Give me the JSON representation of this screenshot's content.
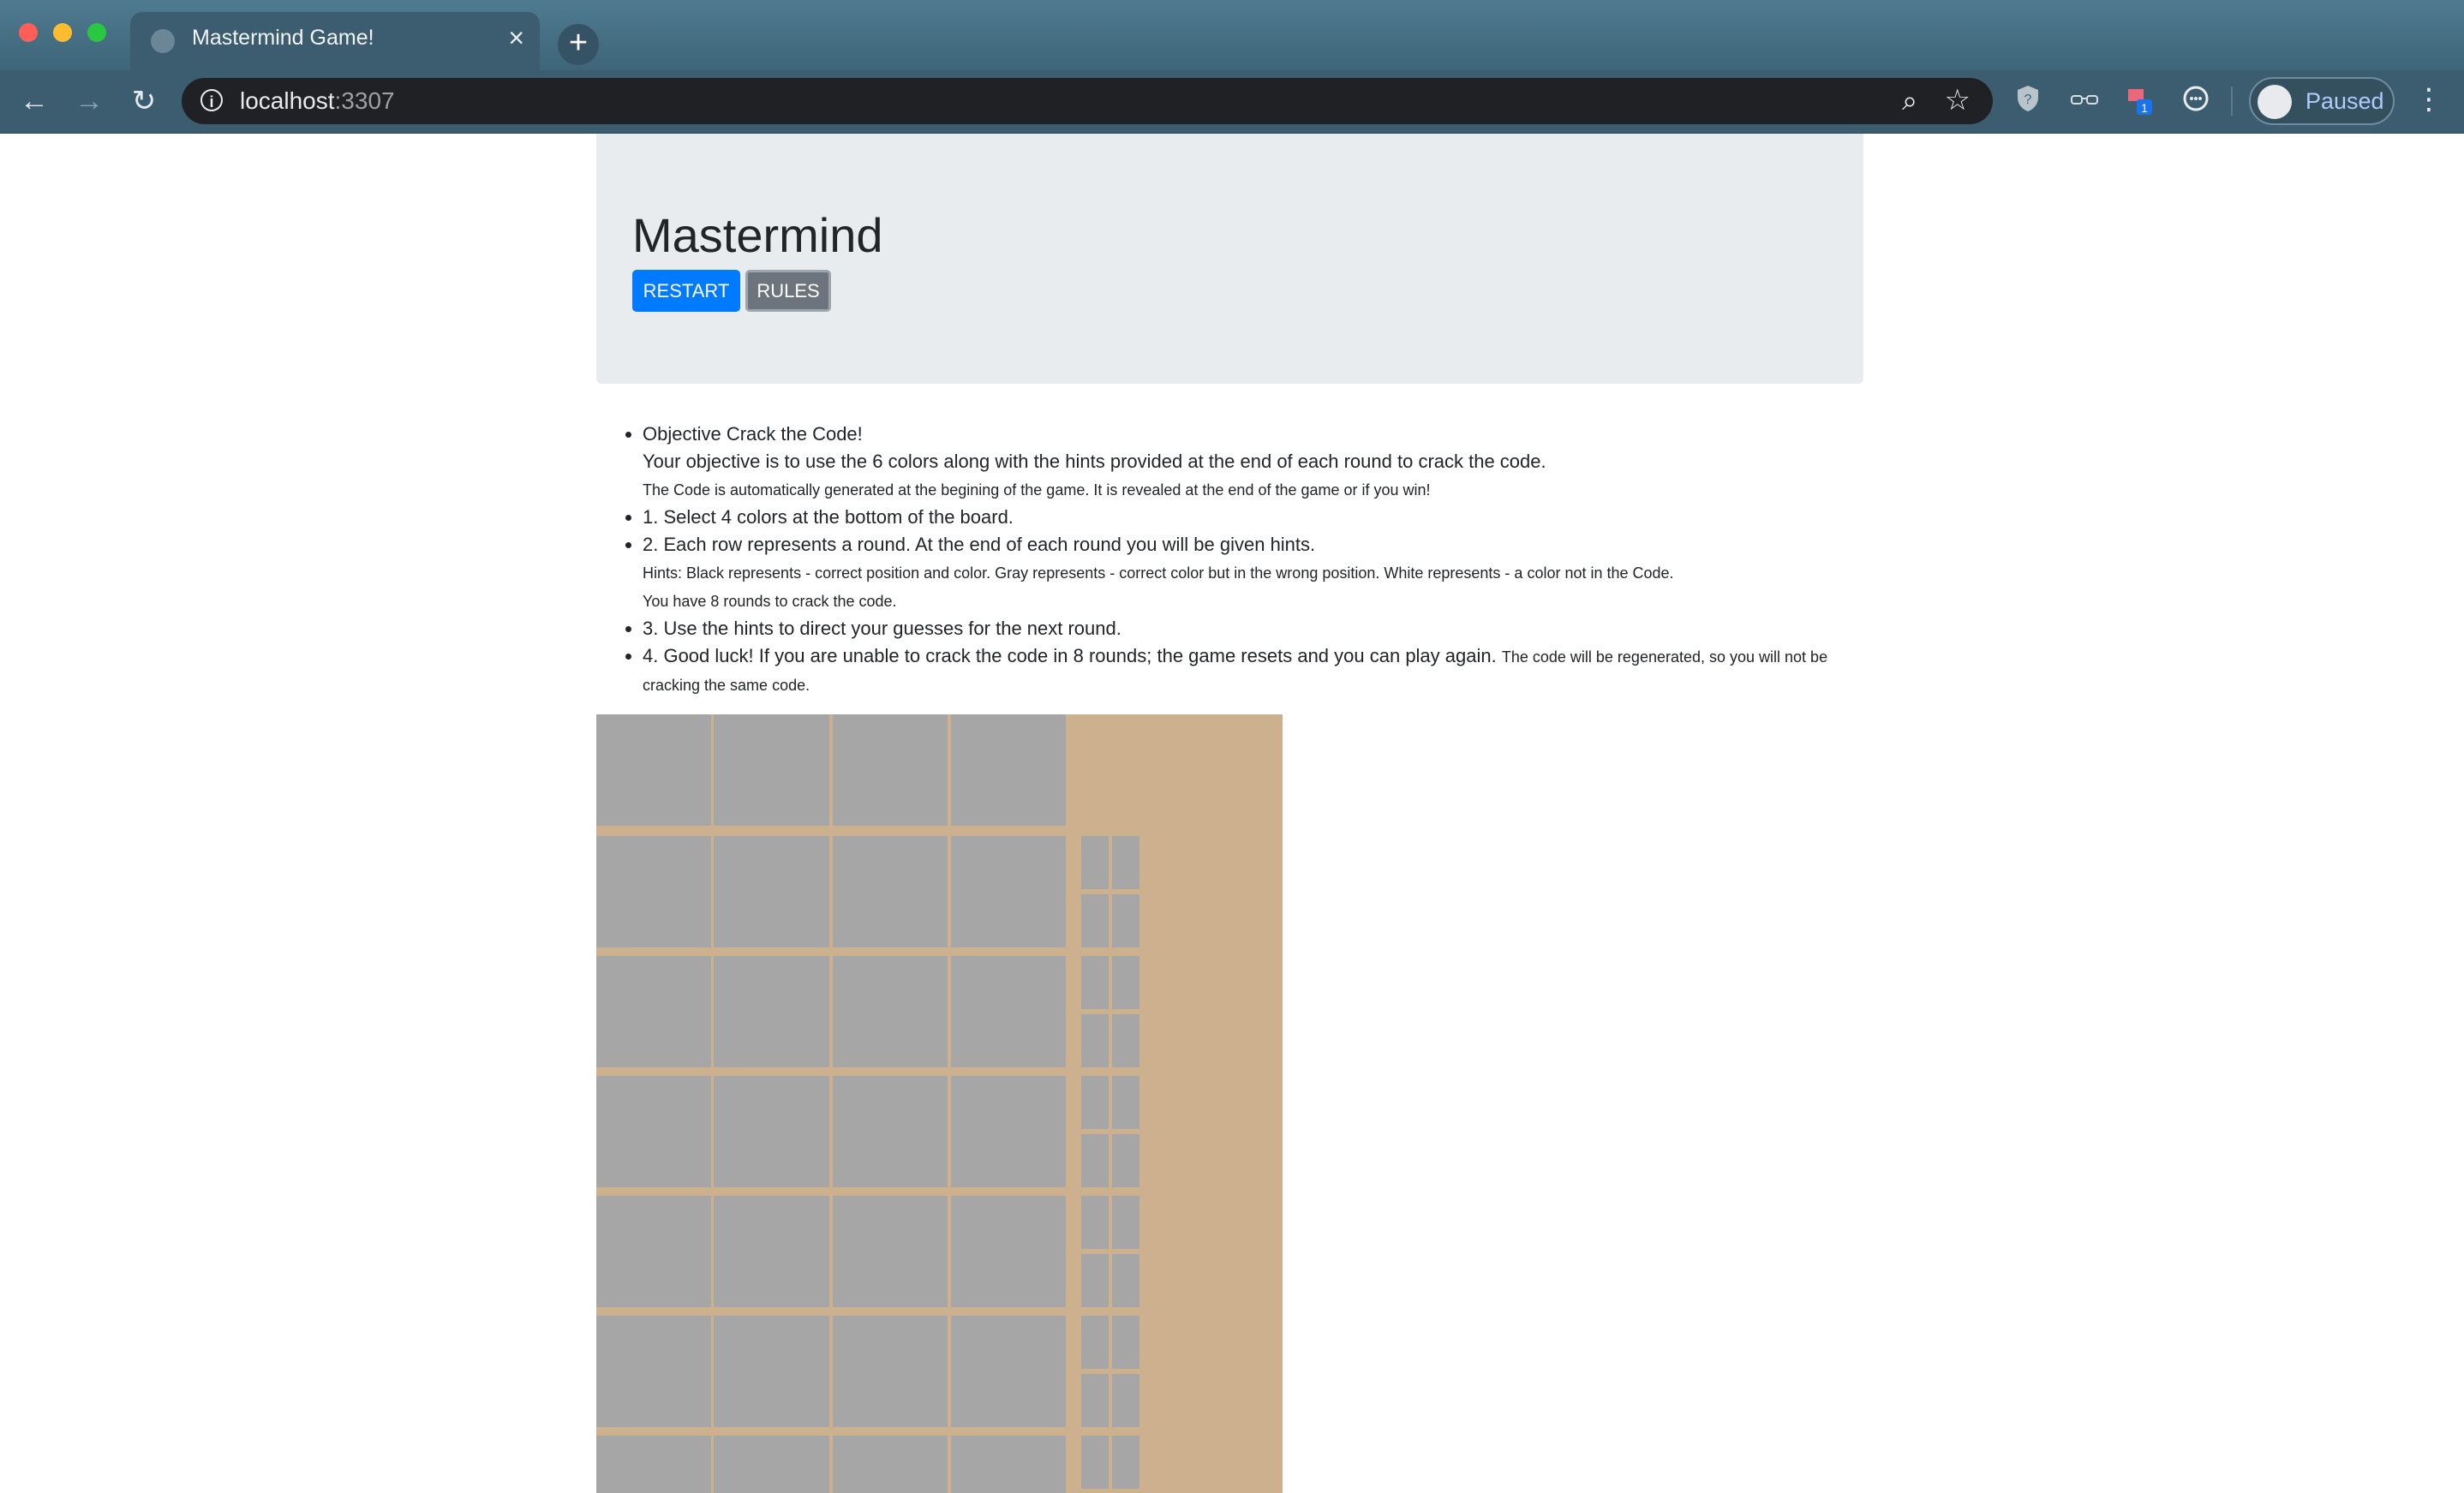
{
  "browser": {
    "tab_title": "Mastermind Game!",
    "url_host": "localhost",
    "url_port": ":3307",
    "profile_label": "Paused",
    "extension_badge": "1"
  },
  "header": {
    "title": "Mastermind",
    "restart_label": "RESTART",
    "rules_label": "RULES"
  },
  "rules": {
    "objective_title": "Objective Crack the Code!",
    "objective_text": "Your objective is to use the 6 colors along with the hints provided at the end of each round to crack the code.",
    "objective_note": "The Code is automatically generated at the begining of the game. It is revealed at the end of the game or if you win!",
    "step1": "1. Select 4 colors at the bottom of the board.",
    "step2": "2. Each row represents a round. At the end of each round you will be given hints.",
    "step2_hints": "Hints: Black represents - correct position and color. Gray represents - correct color but in the wrong position. White represents - a color not in the Code.",
    "step2_rounds": "You have 8 rounds to crack the code.",
    "step3": "3. Use the hints to direct your guesses for the next round.",
    "step4": "4. Good luck! If you are unable to crack the code in 8 rounds; the game resets and you can play again.",
    "step4_note": "The code will be regenerated, so you will not be cracking the same code."
  },
  "colors": {
    "board_bg": "#cdb08d",
    "peg_empty": "#a6a6a6",
    "restart": "#007bff",
    "rules": "#6c757d"
  }
}
